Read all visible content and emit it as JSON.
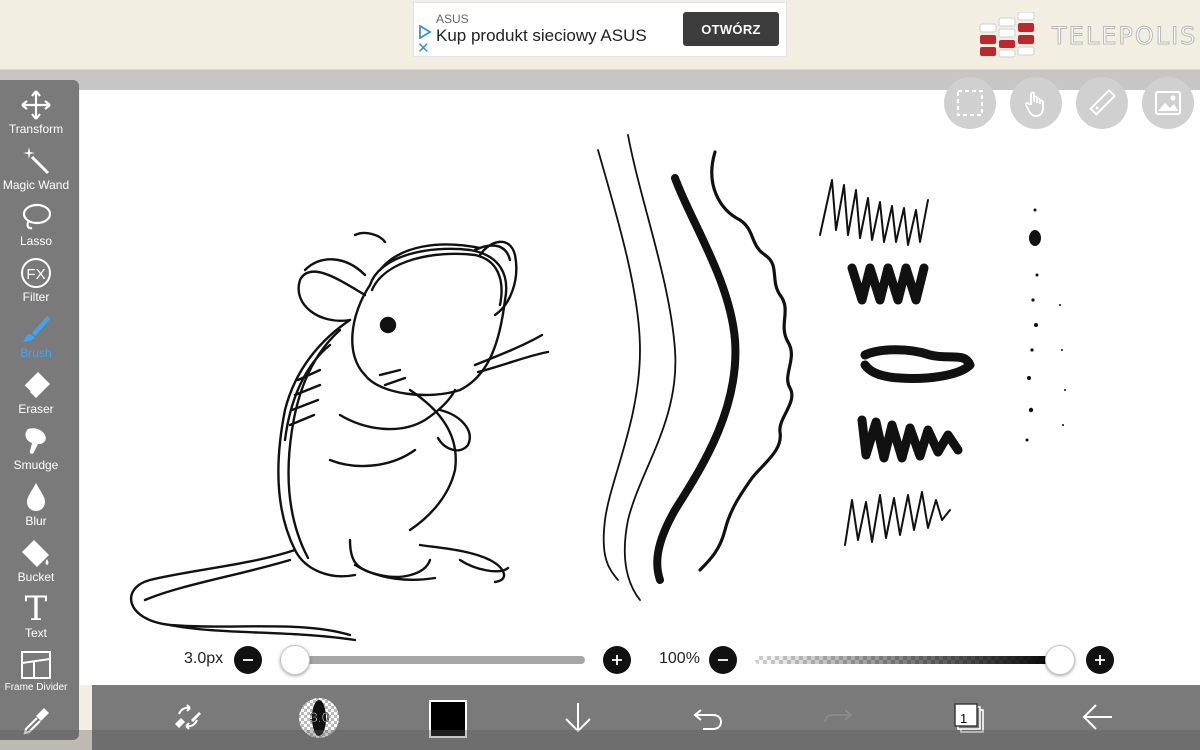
{
  "ad": {
    "brand": "ASUS",
    "text": "Kup produkt sieciowy ASUS",
    "button": "OTWÓRZ"
  },
  "logo": {
    "text": "TELEPOLIS"
  },
  "tools": [
    {
      "label": "Transform",
      "icon": "transform-icon"
    },
    {
      "label": "Magic Wand",
      "icon": "magic-wand-icon"
    },
    {
      "label": "Lasso",
      "icon": "lasso-icon"
    },
    {
      "label": "Filter",
      "icon": "fx-icon"
    },
    {
      "label": "Brush",
      "icon": "brush-icon",
      "active": true
    },
    {
      "label": "Eraser",
      "icon": "eraser-icon"
    },
    {
      "label": "Smudge",
      "icon": "smudge-icon"
    },
    {
      "label": "Blur",
      "icon": "blur-icon"
    },
    {
      "label": "Bucket",
      "icon": "bucket-icon"
    },
    {
      "label": "Text",
      "icon": "text-icon"
    },
    {
      "label": "Frame Divider",
      "icon": "frame-divider-icon"
    }
  ],
  "fx_label": "FX",
  "text_tool_glyph": "T",
  "brush_size": {
    "label": "3.0px",
    "value": 3.0,
    "fraction": 0.05
  },
  "opacity": {
    "label": "100%",
    "value": 100,
    "fraction": 1.0
  },
  "bottom": {
    "brush_badge": "3.0",
    "current_color": "#000000",
    "layer_count": "1"
  },
  "colors": {
    "accent": "#3ea6f0",
    "toolbar": "#7a7a7a",
    "ad_button": "#3c3c3c",
    "logo_red": "#c0272d"
  }
}
